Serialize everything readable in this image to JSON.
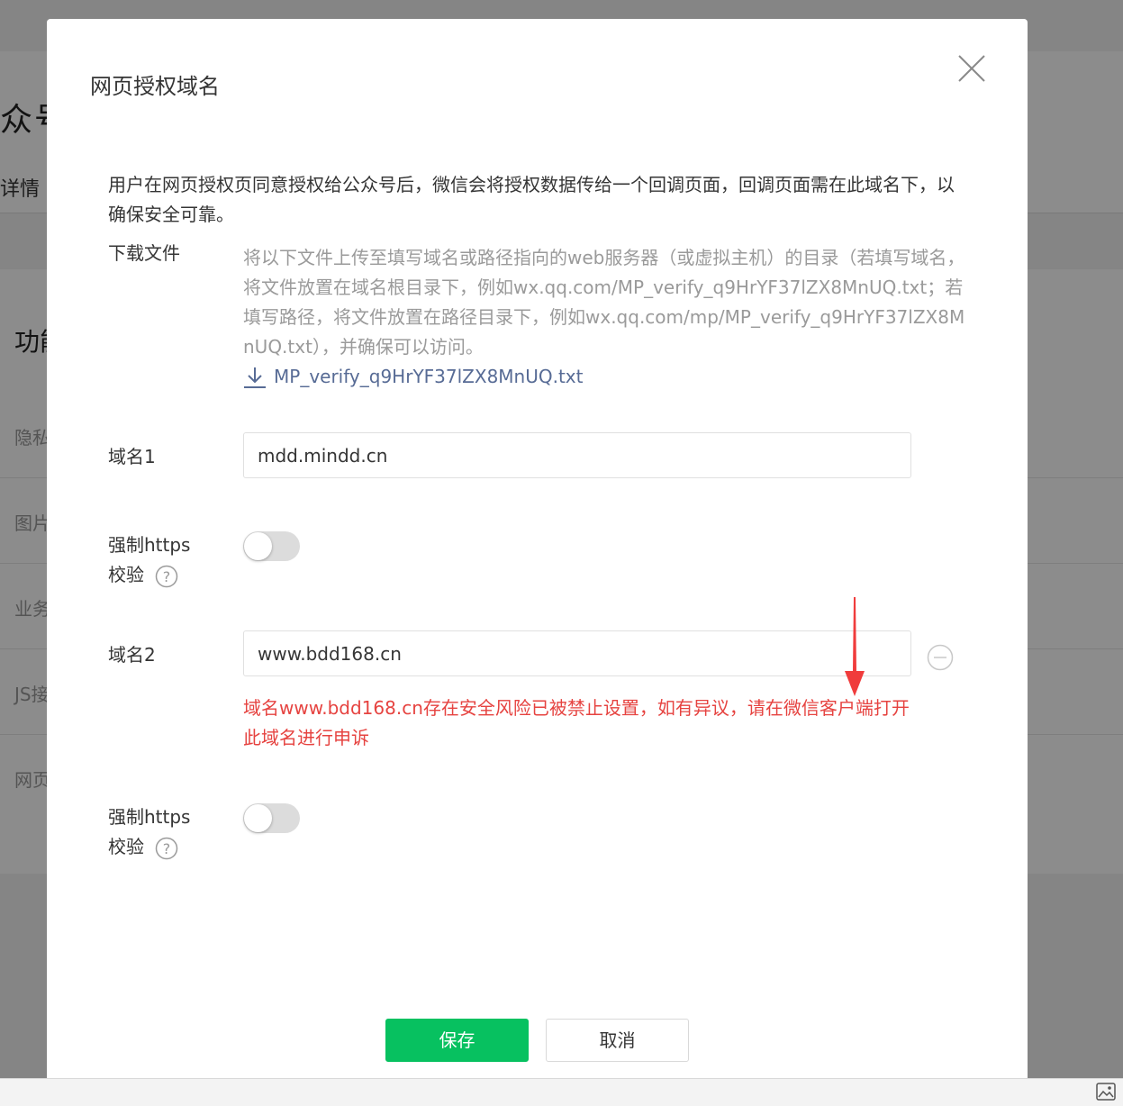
{
  "background": {
    "title": "众号",
    "tab": "详情",
    "section_title": "功能",
    "items": [
      "隐私",
      "图片",
      "业务",
      "JS接",
      "网页"
    ]
  },
  "dialog": {
    "title": "网页授权域名",
    "description": "用户在网页授权页同意授权给公众号后，微信会将授权数据传给一个回调页面，回调页面需在此域名下，以确保安全可靠。",
    "download": {
      "label": "下载文件",
      "instructions": "将以下文件上传至填写域名或路径指向的web服务器（或虚拟主机）的目录（若填写域名，将文件放置在域名根目录下，例如wx.qq.com/MP_verify_q9HrYF37lZX8MnUQ.txt；若填写路径，将文件放置在路径目录下，例如wx.qq.com/mp/MP_verify_q9HrYF37lZX8MnUQ.txt），并确保可以访问。",
      "file_link": "MP_verify_q9HrYF37lZX8MnUQ.txt"
    },
    "domain1": {
      "label": "域名1",
      "value": "mdd.mindd.cn",
      "https_label_line1": "强制https",
      "https_label_line2": "校验",
      "https_enabled": false
    },
    "domain2": {
      "label": "域名2",
      "value": "www.bdd168.cn",
      "error": "域名www.bdd168.cn存在安全风险已被禁止设置，如有异议，请在微信客户端打开此域名进行申诉",
      "https_label_line1": "强制https",
      "https_label_line2": "校验",
      "https_enabled": false
    },
    "save_label": "保存",
    "cancel_label": "取消"
  },
  "colors": {
    "primary": "#07c160",
    "link": "#576b95",
    "error": "#e64340",
    "annotation_arrow": "#f03c3c"
  }
}
